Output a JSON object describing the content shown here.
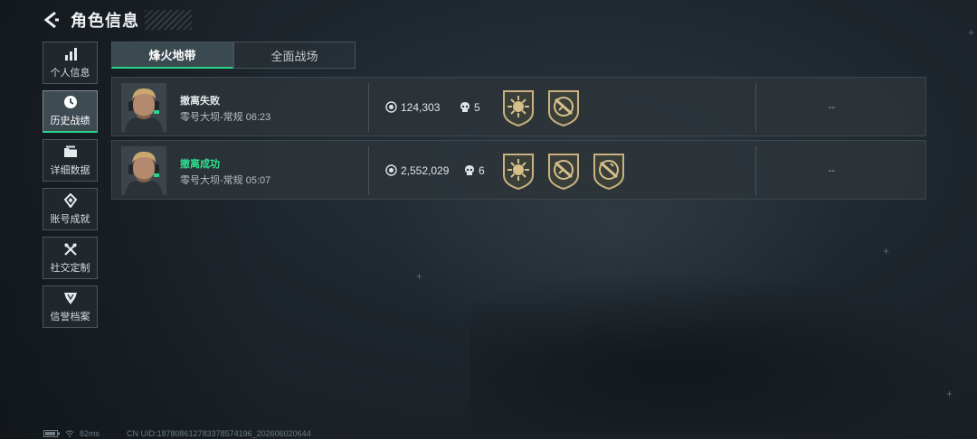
{
  "header": {
    "title": "角色信息",
    "back_icon": "back-arrow-icon"
  },
  "sidebar": {
    "items": [
      {
        "label": "个人信息",
        "icon": "bar-chart-icon",
        "active": false
      },
      {
        "label": "历史战绩",
        "icon": "clock-icon",
        "active": true
      },
      {
        "label": "详细数据",
        "icon": "folder-icon",
        "active": false
      },
      {
        "label": "账号成就",
        "icon": "diamond-icon",
        "active": false
      },
      {
        "label": "社交定制",
        "icon": "wrench-icon",
        "active": false
      },
      {
        "label": "信誉档案",
        "icon": "shield-icon",
        "active": false
      }
    ]
  },
  "tabs": [
    {
      "label": "烽火地带",
      "active": true
    },
    {
      "label": "全面战场",
      "active": false
    }
  ],
  "records": [
    {
      "status": "撤离失败",
      "status_type": "fail",
      "map": "零号大坝-常规 06:23",
      "coins": "124,303",
      "kills": "5",
      "badges": [
        "sun-badge-icon",
        "rifle-badge-icon"
      ],
      "extra": "--"
    },
    {
      "status": "撤离成功",
      "status_type": "success",
      "map": "零号大坝-常规 05:07",
      "coins": "2,552,029",
      "kills": "6",
      "badges": [
        "sun-badge-icon",
        "rifle-badge-icon",
        "rifle-badge-icon"
      ],
      "extra": "--"
    }
  ],
  "footer": {
    "ping": "82ms",
    "uid": "CN UID:18780861278337857419​6_202606020644"
  },
  "colors": {
    "accent": "#2ad48a",
    "success": "#2fe08f",
    "panel": "#2c343a"
  }
}
